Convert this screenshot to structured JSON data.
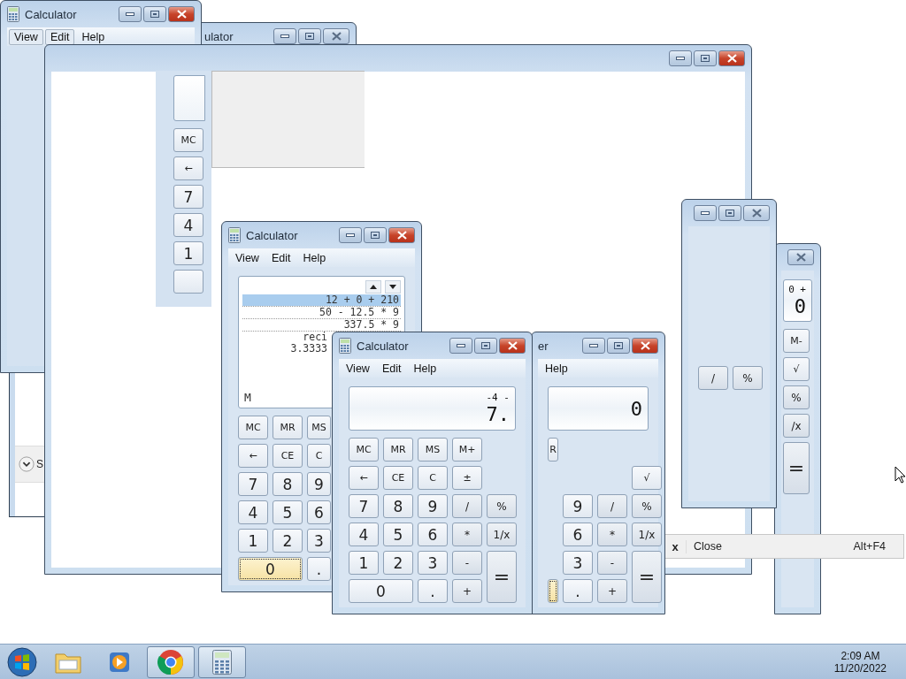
{
  "left_window": {
    "title": "Calculator",
    "active": true,
    "menu": [
      {
        "label": "View",
        "hot": true
      },
      {
        "label": "Edit",
        "hot": true
      },
      {
        "label": "Help",
        "hot": false
      }
    ]
  },
  "dialog_fragment": {
    "text": "S"
  },
  "upper_window": {
    "title": "ulator",
    "active": false,
    "keys": [
      {
        "label": "MC",
        "kind": "mem"
      },
      {
        "label": "←",
        "kind": "fn"
      },
      {
        "label": "7",
        "kind": "num"
      },
      {
        "label": "4",
        "kind": "num"
      },
      {
        "label": "1",
        "kind": "num"
      },
      {
        "kind": "num"
      }
    ]
  },
  "blank_window": {
    "active": true
  },
  "right_window": {
    "active": false,
    "keys": [
      {
        "label": "/",
        "kind": "op"
      },
      {
        "label": "%",
        "kind": "op"
      }
    ]
  },
  "far_right_window": {
    "active": false,
    "expression": "0 +",
    "display": "0",
    "keys": [
      {
        "label": "M-",
        "kind": "mem"
      },
      {
        "label": "√",
        "kind": "fn"
      },
      {
        "label": "%",
        "kind": "op"
      },
      {
        "label": "/x",
        "kind": "op"
      },
      {
        "label": "=",
        "kind": "eq"
      }
    ]
  },
  "history_calculator": {
    "title": "Calculator",
    "active": true,
    "menu": [
      {
        "label": "View",
        "hot": false
      },
      {
        "label": "Edit",
        "hot": false
      },
      {
        "label": "Help",
        "hot": false
      }
    ],
    "history": [
      {
        "text": "12 + 0 + 210",
        "selected": true,
        "kind": "entry"
      },
      {
        "text": "50 - 12.5 * 9",
        "selected": false,
        "kind": "entry"
      },
      {
        "text": "337.5 * 9",
        "selected": false,
        "kind": "entry"
      },
      {
        "text": "reci",
        "selected": false,
        "kind": "partial"
      },
      {
        "text": "3.3333",
        "selected": false,
        "kind": "partial"
      }
    ],
    "memory": "M",
    "keys": [
      {
        "label": "MC",
        "kind": "mem",
        "focused": false
      },
      {
        "label": "MR",
        "kind": "mem",
        "focused": false
      },
      {
        "label": "MS",
        "kind": "mem",
        "focused": false
      },
      {
        "label": "←",
        "kind": "fn",
        "focused": false
      },
      {
        "label": "CE",
        "kind": "fn",
        "focused": false
      },
      {
        "label": "C",
        "kind": "fn",
        "focused": false
      },
      {
        "label": "7",
        "kind": "num",
        "focused": false
      },
      {
        "label": "8",
        "kind": "num",
        "focused": false
      },
      {
        "label": "9",
        "kind": "num",
        "focused": false
      },
      {
        "label": "4",
        "kind": "num",
        "focused": false
      },
      {
        "label": "5",
        "kind": "num",
        "focused": false
      },
      {
        "label": "6",
        "kind": "num",
        "focused": false
      },
      {
        "label": "1",
        "kind": "num",
        "focused": false
      },
      {
        "label": "2",
        "kind": "num",
        "focused": false
      },
      {
        "label": "3",
        "kind": "num",
        "focused": false
      },
      {
        "label": "0",
        "kind": "zero",
        "focused": true
      },
      {
        "label": ".",
        "kind": "num",
        "focused": false
      }
    ]
  },
  "partial_calculator": {
    "title": "er",
    "active": true,
    "menu": [
      {
        "label": "Help",
        "hot": false
      }
    ],
    "display": "0",
    "keys": [
      {
        "label": "R",
        "kind": "mem",
        "focused": false
      },
      {
        "kind": "gap"
      },
      {
        "kind": "gap"
      },
      {
        "kind": "gap"
      },
      {
        "kind": "gap"
      },
      {
        "kind": "gap"
      },
      {
        "kind": "gap"
      },
      {
        "label": "√",
        "kind": "fn",
        "focused": false
      },
      {
        "kind": "gap"
      },
      {
        "label": "9",
        "kind": "num",
        "focused": false
      },
      {
        "label": "/",
        "kind": "op",
        "focused": false
      },
      {
        "label": "%",
        "kind": "op",
        "focused": false
      },
      {
        "kind": "gap"
      },
      {
        "label": "6",
        "kind": "num",
        "focused": false
      },
      {
        "label": "*",
        "kind": "op",
        "focused": false
      },
      {
        "label": "1/x",
        "kind": "op",
        "focused": false
      },
      {
        "kind": "gap"
      },
      {
        "label": "3",
        "kind": "num",
        "focused": false
      },
      {
        "label": "-",
        "kind": "op",
        "focused": false
      },
      {
        "label": "=",
        "kind": "eq",
        "focused": false
      },
      {
        "kind": "num",
        "focused": true
      },
      {
        "label": ".",
        "kind": "num",
        "focused": false
      },
      {
        "label": "+",
        "kind": "op",
        "focused": false
      }
    ]
  },
  "front_calculator": {
    "title": "Calculator",
    "active": true,
    "menu": [
      {
        "label": "View",
        "hot": false
      },
      {
        "label": "Edit",
        "hot": false
      },
      {
        "label": "Help",
        "hot": false
      }
    ],
    "expression": "-4 -",
    "display": "7.",
    "keys": [
      {
        "label": "MC",
        "kind": "mem"
      },
      {
        "label": "MR",
        "kind": "mem"
      },
      {
        "label": "MS",
        "kind": "mem"
      },
      {
        "label": "M+",
        "kind": "mem"
      },
      {
        "kind": "gap"
      },
      {
        "label": "←",
        "kind": "fn"
      },
      {
        "label": "CE",
        "kind": "fn"
      },
      {
        "label": "C",
        "kind": "fn"
      },
      {
        "label": "±",
        "kind": "fn"
      },
      {
        "kind": "gap"
      },
      {
        "label": "7",
        "kind": "num"
      },
      {
        "label": "8",
        "kind": "num"
      },
      {
        "label": "9",
        "kind": "num"
      },
      {
        "label": "/",
        "kind": "op"
      },
      {
        "label": "%",
        "kind": "op"
      },
      {
        "label": "4",
        "kind": "num"
      },
      {
        "label": "5",
        "kind": "num"
      },
      {
        "label": "6",
        "kind": "num"
      },
      {
        "label": "*",
        "kind": "op"
      },
      {
        "label": "1/x",
        "kind": "op"
      },
      {
        "label": "1",
        "kind": "num"
      },
      {
        "label": "2",
        "kind": "num"
      },
      {
        "label": "3",
        "kind": "num"
      },
      {
        "label": "-",
        "kind": "op"
      },
      {
        "label": "=",
        "kind": "eq"
      },
      {
        "label": "0",
        "kind": "zero"
      },
      {
        "label": ".",
        "kind": "num"
      },
      {
        "label": "+",
        "kind": "op"
      }
    ]
  },
  "context_menu": {
    "items": [
      {
        "icon": "x",
        "label": "Close",
        "shortcut": "Alt+F4"
      }
    ]
  },
  "taskbar": {
    "apps": [
      {
        "kind": "explorer",
        "running": false
      },
      {
        "kind": "media",
        "running": false
      },
      {
        "kind": "browser",
        "running": true
      },
      {
        "kind": "calculator",
        "running": true
      }
    ],
    "time": "2:09 AM",
    "date": "11/20/2022"
  }
}
